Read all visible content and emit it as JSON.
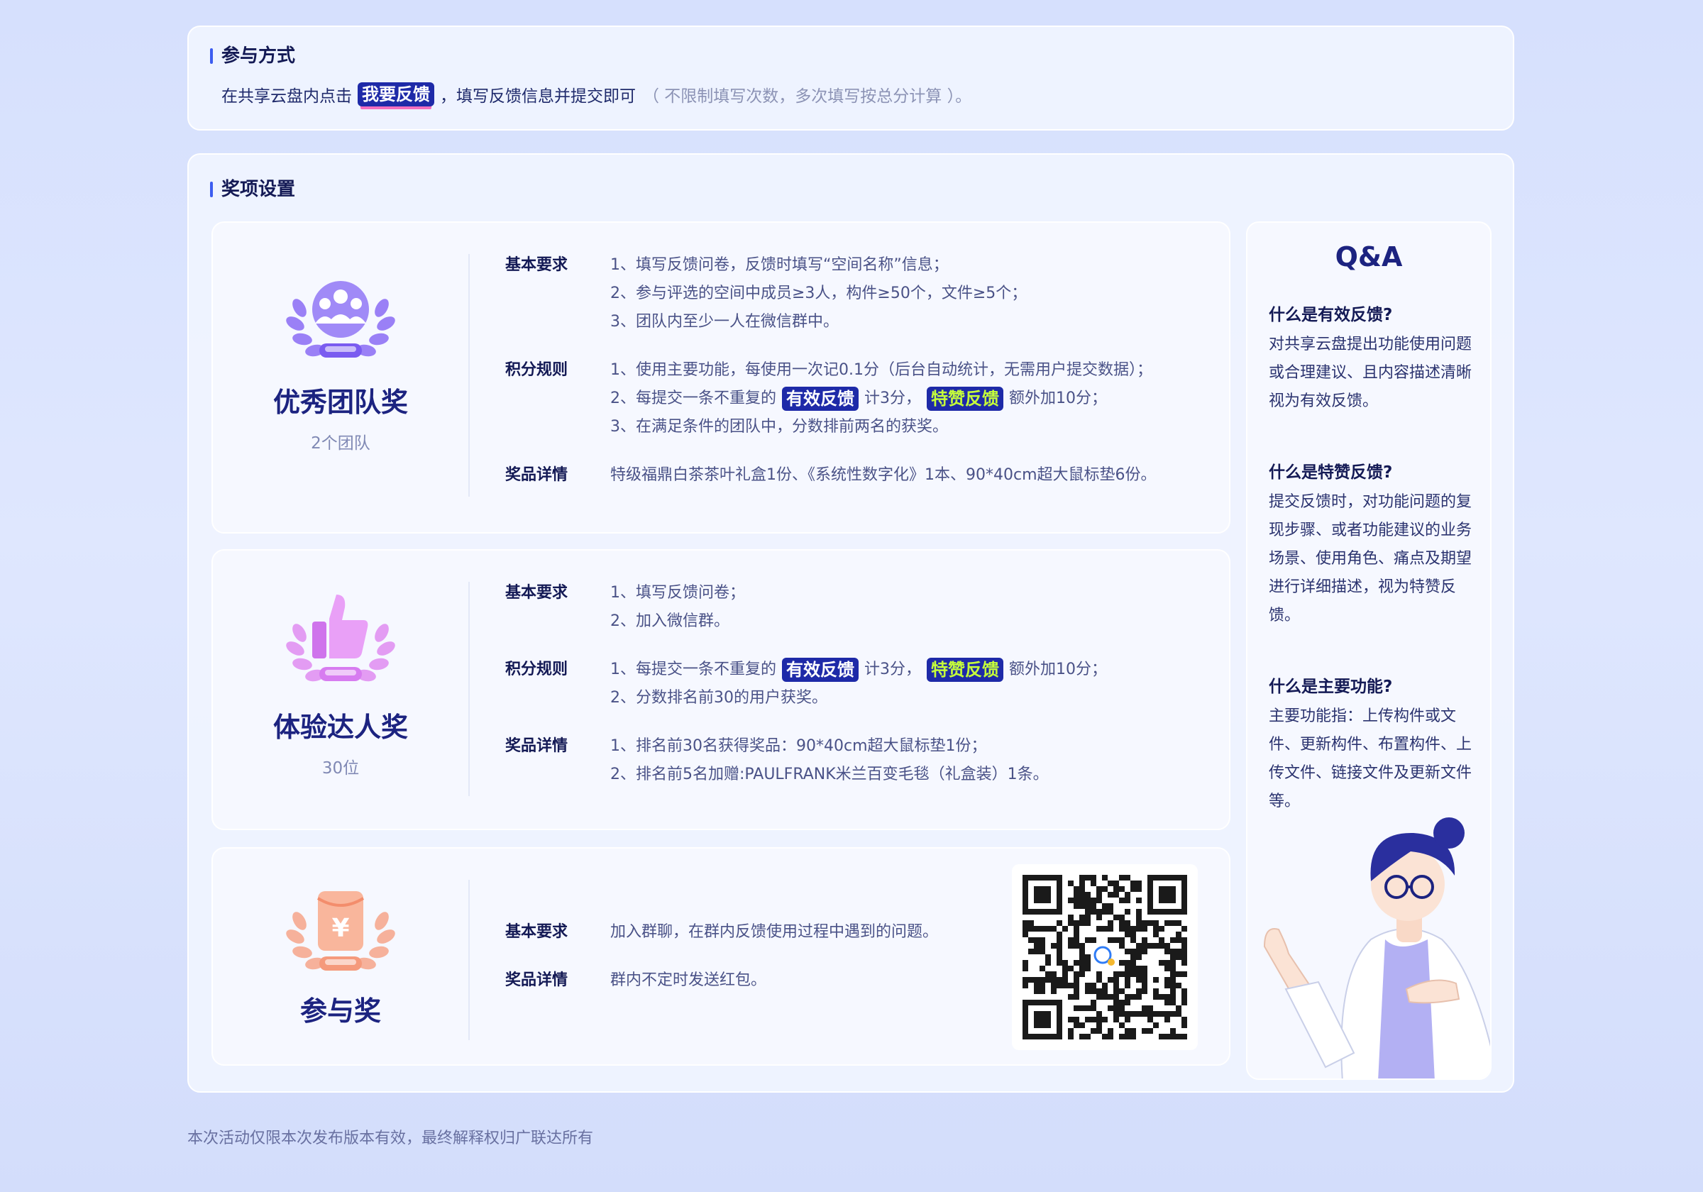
{
  "join": {
    "title": "参与方式",
    "prefix": "在共享云盘内点击",
    "button": "我要反馈",
    "suffix": "，填写反馈信息并提交即可",
    "note": "（ 不限制填写次数，多次填写按总分计算 ）。"
  },
  "awards_title": "奖项设置",
  "labels": {
    "basic": "基本要求",
    "score": "积分规则",
    "prize": "奖品详情"
  },
  "tags": {
    "valid": "有效反馈",
    "special": "特赞反馈"
  },
  "award1": {
    "name": "优秀团队奖",
    "count": "2个团队",
    "basic": [
      "1、填写反馈问卷，反馈时填写“空间名称”信息；",
      "2、参与评选的空间中成员≥3人，构件≥50个，文件≥5个；",
      "3、团队内至少一人在微信群中。"
    ],
    "score1": "1、使用主要功能，每使用一次记0.1分（后台自动统计，无需用户提交数据）；",
    "score2_a": "2、每提交一条不重复的",
    "score2_b": "计3分，",
    "score2_c": "额外加10分；",
    "score3": "3、在满足条件的团队中，分数排前两名的获奖。",
    "prize": "特级福鼎白茶茶叶礼盒1份、《系统性数字化》1本、90*40cm超大鼠标垫6份。"
  },
  "award2": {
    "name": "体验达人奖",
    "count": "30位",
    "basic": [
      "1、填写反馈问卷；",
      "2、加入微信群。"
    ],
    "score1_a": "1、每提交一条不重复的",
    "score1_b": "计3分，",
    "score1_c": "额外加10分；",
    "score2": "2、分数排名前30的用户获奖。",
    "prize": [
      "1、排名前30名获得奖品：90*40cm超大鼠标垫1份；",
      "2、排名前5名加赠:PAULFRANK米兰百变毛毯（礼盒装）1条。"
    ]
  },
  "award3": {
    "name": "参与奖",
    "basic": "加入群聊，在群内反馈使用过程中遇到的问题。",
    "prize": "群内不定时发送红包。"
  },
  "qa": {
    "title": "Q&A",
    "q1": "什么是有效反馈?",
    "a1": "对共享云盘提出功能使用问题或合理建议、且内容描述清晰视为有效反馈。",
    "q2": "什么是特赞反馈?",
    "a2": "提交反馈时，对功能问题的复现步骤、或者功能建议的业务场景、使用角色、痛点及期望进行详细描述，视为特赞反馈。",
    "q3": "什么是主要功能?",
    "a3": "主要功能指：上传构件或文件、更新构件、布置构件、上传文件、链接文件及更新文件等。"
  },
  "footer": "本次活动仅限本次发布版本有效，最终解释权归广联达所有",
  "colors": {
    "accent": "#1e2aa8",
    "team": "#8b6cf5",
    "expert": "#e08cf2",
    "join": "#f7a58a"
  },
  "icons": {
    "team": "team-laurel-icon",
    "expert": "thumbs-up-laurel-icon",
    "join": "red-envelope-laurel-icon",
    "qr": "wechat-group-qr-icon"
  }
}
